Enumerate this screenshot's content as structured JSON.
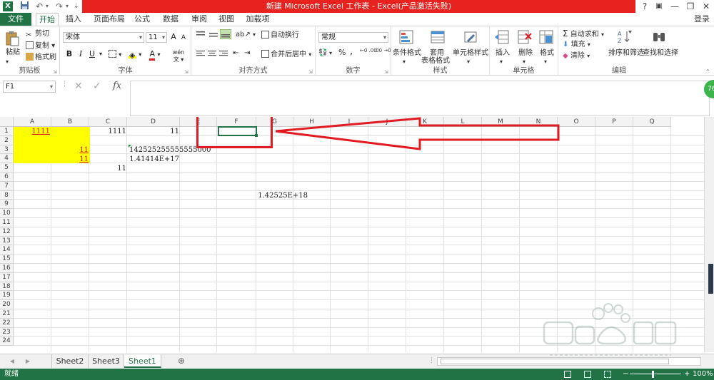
{
  "window": {
    "title": "新建 Microsoft Excel 工作表 - Excel(产品激活失败)",
    "help": "?",
    "restore": "▣",
    "minimize": "—",
    "maximize": "❐",
    "close": "✕",
    "login": "登录"
  },
  "tabs": [
    {
      "label": "文件"
    },
    {
      "label": "开始"
    },
    {
      "label": "插入"
    },
    {
      "label": "页面布局"
    },
    {
      "label": "公式"
    },
    {
      "label": "数据"
    },
    {
      "label": "审阅"
    },
    {
      "label": "视图"
    },
    {
      "label": "加载项"
    }
  ],
  "ribbon": {
    "clipboard": {
      "paste": "粘贴",
      "cut": "剪切",
      "copy": "复制",
      "painter": "格式刷",
      "label": "剪贴板"
    },
    "font": {
      "name": "宋体",
      "size": "11",
      "bold": "B",
      "italic": "I",
      "underline": "U",
      "grow": "A",
      "shrink": "A",
      "label": "字体",
      "wen": "wén"
    },
    "alignment": {
      "wrap": "自动换行",
      "merge": "合并后居中",
      "label": "对齐方式"
    },
    "number": {
      "format": "常规",
      "percent": "%",
      "comma": ",",
      "label": "数字",
      "inc": "←0 .00",
      "dec": ".00 →0"
    },
    "styles": {
      "conditional": "条件格式",
      "table1": "套用",
      "table2": "表格格式",
      "cell": "单元格样式",
      "label": "样式"
    },
    "cells": {
      "insert": "插入",
      "delete": "删除",
      "format": "格式",
      "label": "单元格"
    },
    "editing": {
      "autosum": "自动求和",
      "fill": "填充",
      "clear": "清除",
      "sort": "排序和筛选",
      "find": "查找和选择",
      "label": "编辑"
    }
  },
  "formula_bar": {
    "name_box": "F1",
    "fx": "fx",
    "value": "",
    "badge": "76"
  },
  "columns": [
    "A",
    "B",
    "C",
    "D",
    "E",
    "F",
    "G",
    "H",
    "I",
    "J",
    "K",
    "L",
    "M",
    "N",
    "O",
    "P",
    "Q"
  ],
  "rows": [
    "1",
    "2",
    "3",
    "4",
    "5",
    "6",
    "7",
    "8",
    "9",
    "10",
    "11",
    "12",
    "13",
    "14",
    "15",
    "16",
    "17",
    "18",
    "19",
    "20",
    "21",
    "22",
    "23",
    "24"
  ],
  "cells": {
    "A1": "1111",
    "C1": "1111",
    "D1": "11",
    "B3": "11",
    "D3": "142525255555555000",
    "B4": "11",
    "D4": "1.41414E+17",
    "C5": "11",
    "G8": "1.42525E+18"
  },
  "sheets": [
    {
      "label": "Sheet2"
    },
    {
      "label": "Sheet3"
    },
    {
      "label": "Sheet1"
    }
  ],
  "sheet_nav": {
    "prev": "◀",
    "next": "▶",
    "add": "⊕"
  },
  "status": {
    "mode": "就绪",
    "zoom": "100%",
    "minus": "−",
    "plus": "+"
  },
  "colors": {
    "excel_green": "#217346",
    "title_red": "#e8231f",
    "highlight_yellow": "#ffff00",
    "annotation_red": "#e01b22"
  }
}
